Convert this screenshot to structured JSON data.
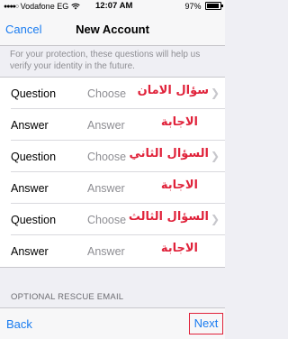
{
  "status_bar": {
    "signal": "●●●●○",
    "carrier": "Vodafone EG",
    "wifi_icon": "wifi-icon",
    "time": "12:07 AM",
    "battery_percent": "97%"
  },
  "nav": {
    "cancel_label": "Cancel",
    "title": "New Account"
  },
  "info_text": "For your protection, these questions will help us verify your identity in the future.",
  "rows": [
    {
      "label": "Question",
      "value": "Choose",
      "annotation": "سؤال الامان"
    },
    {
      "label": "Answer",
      "value": "Answer",
      "annotation": "الاجابة"
    },
    {
      "label": "Question",
      "value": "Choose",
      "annotation": "السؤال الثاني"
    },
    {
      "label": "Answer",
      "value": "Answer",
      "annotation": "الاجابة"
    },
    {
      "label": "Question",
      "value": "Choose",
      "annotation": "السؤال الثالث"
    },
    {
      "label": "Answer",
      "value": "Answer",
      "annotation": "الاجابة"
    }
  ],
  "section_header": "OPTIONAL RESCUE EMAIL",
  "toolbar": {
    "back_label": "Back",
    "next_label": "Next"
  },
  "colors": {
    "accent": "#1a7cf0",
    "annotation": "#e0223a",
    "background": "#efeff4"
  }
}
